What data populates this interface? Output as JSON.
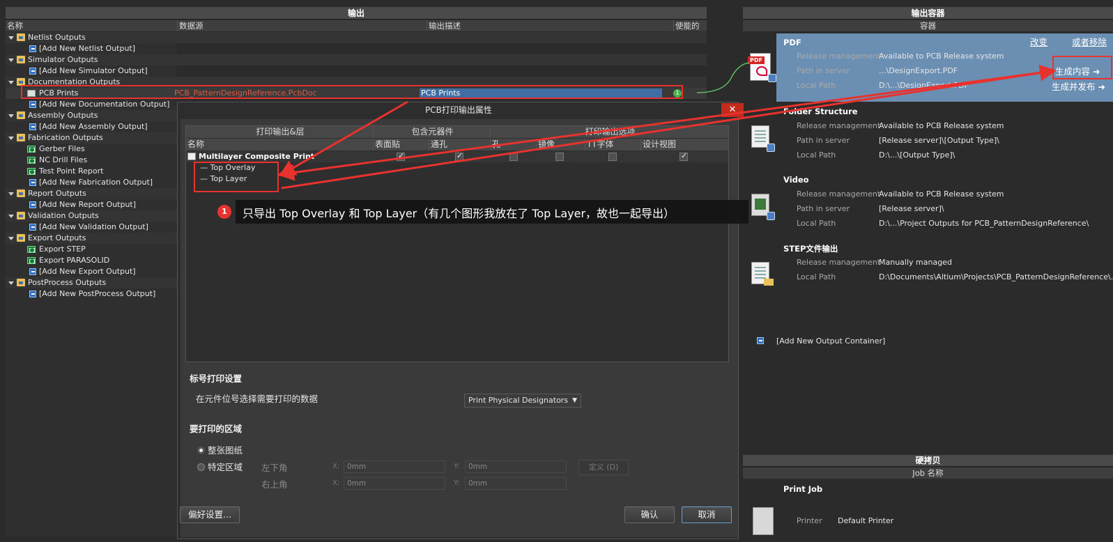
{
  "left_panel": {
    "title": "输出",
    "columns": {
      "name": "名称",
      "source": "数据源",
      "desc": "输出描述",
      "enabled": "使能的"
    },
    "rows": [
      {
        "label": "Netlist Outputs",
        "kind": "group"
      },
      {
        "label": "[Add New Netlist Output]",
        "kind": "add"
      },
      {
        "label": "Simulator Outputs",
        "kind": "group"
      },
      {
        "label": "[Add New Simulator Output]",
        "kind": "add"
      },
      {
        "label": "Documentation Outputs",
        "kind": "group"
      },
      {
        "label": "PCB Prints",
        "kind": "item",
        "source": "PCB_PatternDesignReference.PcbDoc",
        "desc": "PCB Prints",
        "link_badge": "1"
      },
      {
        "label": "[Add New Documentation Output]",
        "kind": "add"
      },
      {
        "label": "Assembly Outputs",
        "kind": "group"
      },
      {
        "label": "[Add New Assembly Output]",
        "kind": "add"
      },
      {
        "label": "Fabrication Outputs",
        "kind": "group"
      },
      {
        "label": "Gerber Files",
        "kind": "item"
      },
      {
        "label": "NC Drill Files",
        "kind": "item"
      },
      {
        "label": "Test Point Report",
        "kind": "item"
      },
      {
        "label": "[Add New Fabrication Output]",
        "kind": "add"
      },
      {
        "label": "Report Outputs",
        "kind": "group"
      },
      {
        "label": "[Add New Report Output]",
        "kind": "add"
      },
      {
        "label": "Validation Outputs",
        "kind": "group"
      },
      {
        "label": "[Add New Validation Output]",
        "kind": "add"
      },
      {
        "label": "Export Outputs",
        "kind": "group"
      },
      {
        "label": "Export STEP",
        "kind": "item"
      },
      {
        "label": "Export PARASOLID",
        "kind": "item"
      },
      {
        "label": "[Add New Export Output]",
        "kind": "add"
      },
      {
        "label": "PostProcess Outputs",
        "kind": "group"
      },
      {
        "label": "[Add New PostProcess Output]",
        "kind": "add"
      }
    ]
  },
  "dialog": {
    "title": "PCB打印输出属性",
    "close_icon": "close-icon",
    "group_headers": {
      "layers": "打印输出&层",
      "components": "包含元器件",
      "options": "打印输出选项"
    },
    "columns": {
      "name": "名称",
      "smd": "表面贴",
      "thru": "通孔",
      "hole": "孔",
      "mirror": "镜像",
      "tt": "TT字体",
      "design": "设计视图"
    },
    "composite": {
      "label": "Multilayer Composite Print",
      "smd": true,
      "thru": true,
      "hole": false,
      "mirror": false,
      "tt": false,
      "design": true
    },
    "layers": [
      "Top Overlay",
      "Top Layer"
    ],
    "designator_section": {
      "title": "标号打印设置",
      "label": "在元件位号选择需要打印的数据",
      "select_value": "Print Physical Designators"
    },
    "area_section": {
      "title": "要打印的区域",
      "radio_whole": "整张图纸",
      "radio_specific": "特定区域",
      "selected": "whole",
      "lower_left": "左下角",
      "upper_right": "右上角",
      "x_label": "X:",
      "y_label": "Y:",
      "ll_x": "0mm",
      "ll_y": "0mm",
      "ur_x": "0mm",
      "ur_y": "0mm",
      "define_button": "定义 (D)"
    },
    "pref_button": "偏好设置...",
    "ok_button": "确认",
    "cancel_button": "取消"
  },
  "annotation": {
    "number": "1",
    "text": "只导出 Top Overlay 和 Top Layer（有几个图形我放在了 Top Layer，故也一起导出）",
    "color": "#e8322e"
  },
  "right_panel": {
    "title": "输出容器",
    "subtitle": "容器",
    "change_link": "改变",
    "remove_link": "或者移除",
    "generate_content": "生成内容",
    "generate_publish": "生成并发布",
    "containers": [
      {
        "title": "PDF",
        "rows": [
          [
            "Release management",
            "Available to PCB Release system"
          ],
          [
            "Path in server",
            "...\\DesignExport.PDF"
          ],
          [
            "Local Path",
            "D:\\...\\DesignExport.PDF"
          ]
        ]
      },
      {
        "title": "Folder Structure",
        "rows": [
          [
            "Release management",
            "Available to PCB Release system"
          ],
          [
            "Path in server",
            "[Release server]\\[Output Type]\\"
          ],
          [
            "Local Path",
            "D:\\...\\[Output Type]\\"
          ]
        ]
      },
      {
        "title": "Video",
        "rows": [
          [
            "Release management",
            "Available to PCB Release system"
          ],
          [
            "Path in server",
            "[Release server]\\"
          ],
          [
            "Local Path",
            "D:\\...\\Project Outputs for PCB_PatternDesignReference\\"
          ]
        ]
      },
      {
        "title": "STEP文件输出",
        "rows": [
          [
            "Release management",
            "Manually managed"
          ],
          [
            "Local Path",
            "D:\\Documents\\Altium\\Projects\\PCB_PatternDesignReference\\.\\"
          ]
        ]
      }
    ],
    "add_container": "[Add New Output Container]",
    "hardcopy_title": "硬拷贝",
    "job_name_header": "Job 名称",
    "print_job": "Print Job",
    "printer_label": "Printer",
    "printer_value": "Default Printer",
    "accent": "#6b8fb3"
  }
}
